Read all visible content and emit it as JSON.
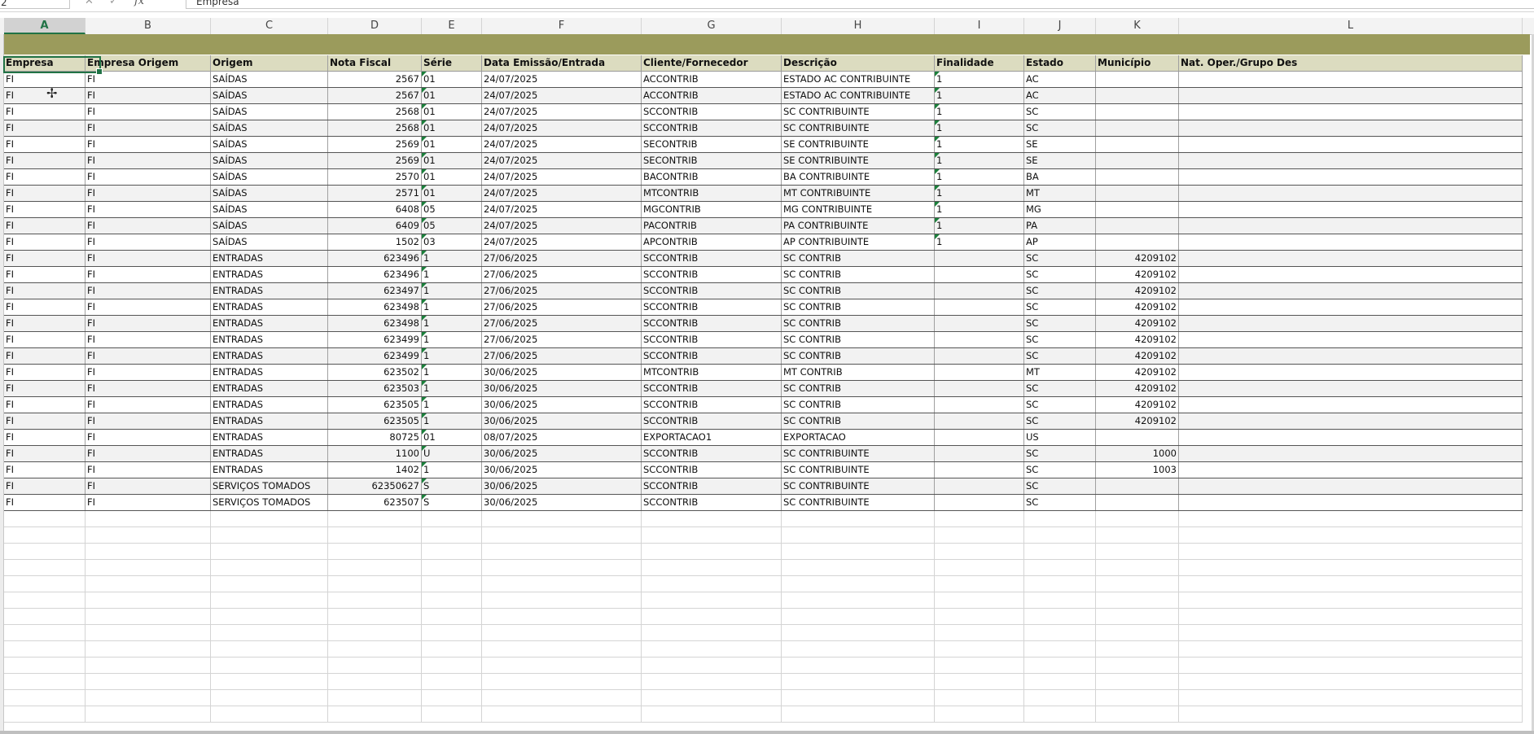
{
  "formula_bar": {
    "name_box": "2",
    "cancel_glyph": "✕",
    "enter_glyph": "✓",
    "fx_label": "fx",
    "formula_value": "Empresa"
  },
  "column_letters": [
    "A",
    "B",
    "C",
    "D",
    "E",
    "F",
    "G",
    "H",
    "I",
    "J",
    "K",
    "L"
  ],
  "selected_column": "A",
  "table": {
    "headers": [
      "Empresa",
      "Empresa Origem",
      "Origem",
      "Nota Fiscal",
      "Série",
      "Data Emissão/Entrada",
      "Cliente/Fornecedor",
      "Descrição",
      "Finalidade",
      "Estado",
      "Município",
      "Nat. Oper./Grupo Des"
    ],
    "rows": [
      [
        "FI",
        "FI",
        "SAÍDAS",
        "2567",
        "01",
        "24/07/2025",
        "ACCONTRIB",
        "ESTADO AC CONTRIBUINTE",
        "1",
        "AC",
        "",
        ""
      ],
      [
        "FI",
        "FI",
        "SAÍDAS",
        "2567",
        "01",
        "24/07/2025",
        "ACCONTRIB",
        "ESTADO AC CONTRIBUINTE",
        "1",
        "AC",
        "",
        ""
      ],
      [
        "FI",
        "FI",
        "SAÍDAS",
        "2568",
        "01",
        "24/07/2025",
        "SCCONTRIB",
        "SC CONTRIBUINTE",
        "1",
        "SC",
        "",
        ""
      ],
      [
        "FI",
        "FI",
        "SAÍDAS",
        "2568",
        "01",
        "24/07/2025",
        "SCCONTRIB",
        "SC CONTRIBUINTE",
        "1",
        "SC",
        "",
        ""
      ],
      [
        "FI",
        "FI",
        "SAÍDAS",
        "2569",
        "01",
        "24/07/2025",
        "SECONTRIB",
        "SE CONTRIBUINTE",
        "1",
        "SE",
        "",
        ""
      ],
      [
        "FI",
        "FI",
        "SAÍDAS",
        "2569",
        "01",
        "24/07/2025",
        "SECONTRIB",
        "SE CONTRIBUINTE",
        "1",
        "SE",
        "",
        ""
      ],
      [
        "FI",
        "FI",
        "SAÍDAS",
        "2570",
        "01",
        "24/07/2025",
        "BACONTRIB",
        "BA CONTRIBUINTE",
        "1",
        "BA",
        "",
        ""
      ],
      [
        "FI",
        "FI",
        "SAÍDAS",
        "2571",
        "01",
        "24/07/2025",
        "MTCONTRIB",
        "MT CONTRIBUINTE",
        "1",
        "MT",
        "",
        ""
      ],
      [
        "FI",
        "FI",
        "SAÍDAS",
        "6408",
        "05",
        "24/07/2025",
        "MGCONTRIB",
        "MG CONTRIBUINTE",
        "1",
        "MG",
        "",
        ""
      ],
      [
        "FI",
        "FI",
        "SAÍDAS",
        "6409",
        "05",
        "24/07/2025",
        "PACONTRIB",
        "PA CONTRIBUINTE",
        "1",
        "PA",
        "",
        ""
      ],
      [
        "FI",
        "FI",
        "SAÍDAS",
        "1502",
        "03",
        "24/07/2025",
        "APCONTRIB",
        "AP CONTRIBUINTE",
        "1",
        "AP",
        "",
        ""
      ],
      [
        "FI",
        "FI",
        "ENTRADAS",
        "623496",
        "1",
        "27/06/2025",
        "SCCONTRIB",
        "SC CONTRIB",
        "",
        "SC",
        "4209102",
        ""
      ],
      [
        "FI",
        "FI",
        "ENTRADAS",
        "623496",
        "1",
        "27/06/2025",
        "SCCONTRIB",
        "SC CONTRIB",
        "",
        "SC",
        "4209102",
        ""
      ],
      [
        "FI",
        "FI",
        "ENTRADAS",
        "623497",
        "1",
        "27/06/2025",
        "SCCONTRIB",
        "SC CONTRIB",
        "",
        "SC",
        "4209102",
        ""
      ],
      [
        "FI",
        "FI",
        "ENTRADAS",
        "623498",
        "1",
        "27/06/2025",
        "SCCONTRIB",
        "SC CONTRIB",
        "",
        "SC",
        "4209102",
        ""
      ],
      [
        "FI",
        "FI",
        "ENTRADAS",
        "623498",
        "1",
        "27/06/2025",
        "SCCONTRIB",
        "SC CONTRIB",
        "",
        "SC",
        "4209102",
        ""
      ],
      [
        "FI",
        "FI",
        "ENTRADAS",
        "623499",
        "1",
        "27/06/2025",
        "SCCONTRIB",
        "SC CONTRIB",
        "",
        "SC",
        "4209102",
        ""
      ],
      [
        "FI",
        "FI",
        "ENTRADAS",
        "623499",
        "1",
        "27/06/2025",
        "SCCONTRIB",
        "SC CONTRIB",
        "",
        "SC",
        "4209102",
        ""
      ],
      [
        "FI",
        "FI",
        "ENTRADAS",
        "623502",
        "1",
        "30/06/2025",
        "MTCONTRIB",
        "MT CONTRIB",
        "",
        "MT",
        "4209102",
        ""
      ],
      [
        "FI",
        "FI",
        "ENTRADAS",
        "623503",
        "1",
        "30/06/2025",
        "SCCONTRIB",
        "SC CONTRIB",
        "",
        "SC",
        "4209102",
        ""
      ],
      [
        "FI",
        "FI",
        "ENTRADAS",
        "623505",
        "1",
        "30/06/2025",
        "SCCONTRIB",
        "SC CONTRIB",
        "",
        "SC",
        "4209102",
        ""
      ],
      [
        "FI",
        "FI",
        "ENTRADAS",
        "623505",
        "1",
        "30/06/2025",
        "SCCONTRIB",
        "SC CONTRIB",
        "",
        "SC",
        "4209102",
        ""
      ],
      [
        "FI",
        "FI",
        "ENTRADAS",
        "80725",
        "01",
        "08/07/2025",
        "EXPORTACAO1",
        "EXPORTACAO",
        "",
        "US",
        "",
        ""
      ],
      [
        "FI",
        "FI",
        "ENTRADAS",
        "1100",
        "U",
        "30/06/2025",
        "SCCONTRIB",
        "SC CONTRIBUINTE",
        "",
        "SC",
        "1000",
        ""
      ],
      [
        "FI",
        "FI",
        "ENTRADAS",
        "1402",
        "1",
        "30/06/2025",
        "SCCONTRIB",
        "SC CONTRIBUINTE",
        "",
        "SC",
        "1003",
        ""
      ],
      [
        "FI",
        "FI",
        "SERVIÇOS TOMADOS",
        "62350627",
        "S",
        "30/06/2025",
        "SCCONTRIB",
        "SC CONTRIBUINTE",
        "",
        "SC",
        "",
        ""
      ],
      [
        "FI",
        "FI",
        "SERVIÇOS TOMADOS",
        "623507",
        "S",
        "30/06/2025",
        "SCCONTRIB",
        "SC CONTRIBUINTE",
        "",
        "SC",
        "",
        ""
      ]
    ]
  },
  "colors": {
    "banner": "#9b9b5c",
    "header_row": "#dcdcc0",
    "selection": "#217346",
    "error_marker": "#1a7f3a"
  },
  "icons": {
    "cursor": "cell-select-cursor-icon"
  }
}
